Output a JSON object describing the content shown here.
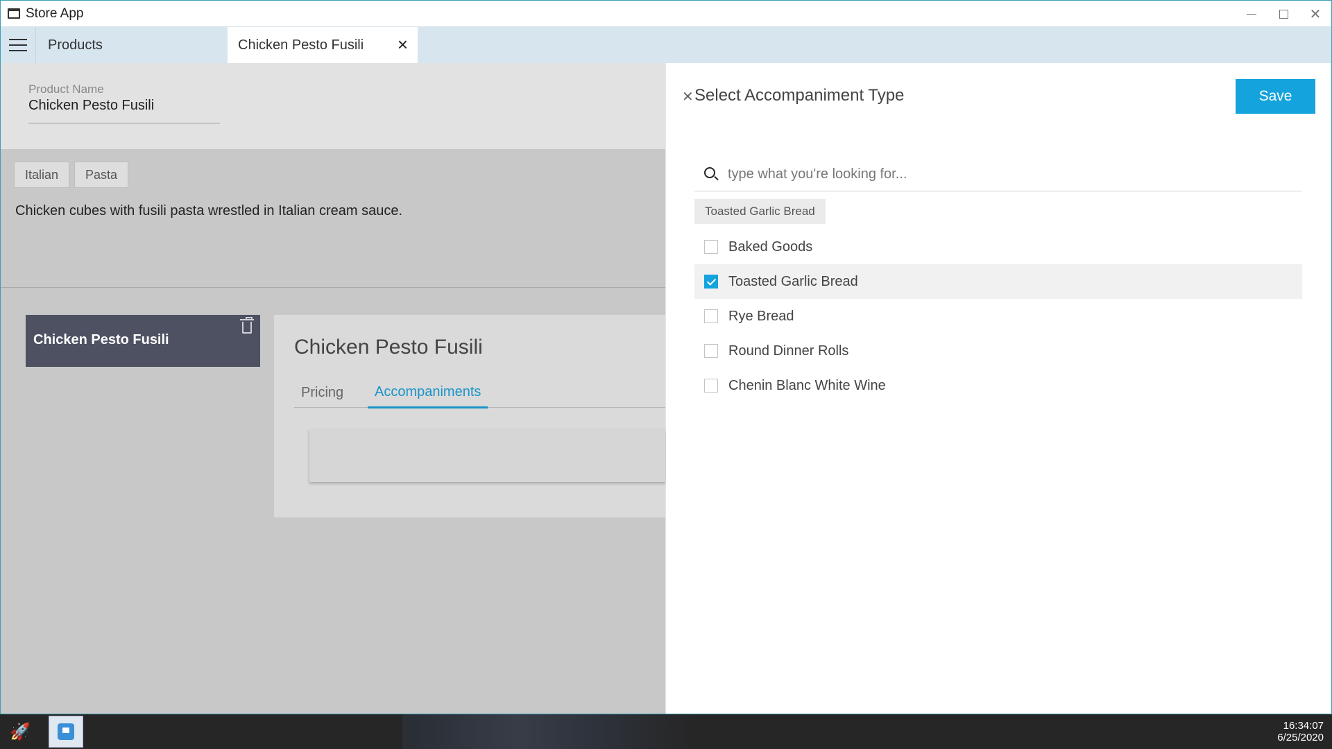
{
  "window": {
    "title": "Store App"
  },
  "tabs": {
    "products_label": "Products",
    "active_label": "Chicken Pesto Fusili"
  },
  "product": {
    "name_label": "Product Name",
    "name_value": "Chicken Pesto Fusili",
    "tags": [
      "Italian",
      "Pasta"
    ],
    "description": "Chicken cubes with fusili pasta wrestled in Italian cream sauce."
  },
  "variant_card": {
    "name": "Chicken Pesto Fusili"
  },
  "detail": {
    "title": "Chicken Pesto Fusili",
    "tab_pricing": "Pricing",
    "tab_accompaniments": "Accompaniments"
  },
  "accompaniment_panel": {
    "title": "Select Accompaniment Type",
    "save_label": "Save",
    "search_placeholder": "type what you're looking for...",
    "selected_chip": "Toasted Garlic Bread",
    "options": [
      {
        "label": "Baked Goods",
        "checked": false
      },
      {
        "label": "Toasted Garlic Bread",
        "checked": true
      },
      {
        "label": "Rye Bread",
        "checked": false
      },
      {
        "label": "Round Dinner Rolls",
        "checked": false
      },
      {
        "label": "Chenin Blanc White Wine",
        "checked": false
      }
    ],
    "accent_color": "#14a3dc"
  },
  "taskbar": {
    "time": "16:34:07",
    "date": "6/25/2020"
  }
}
